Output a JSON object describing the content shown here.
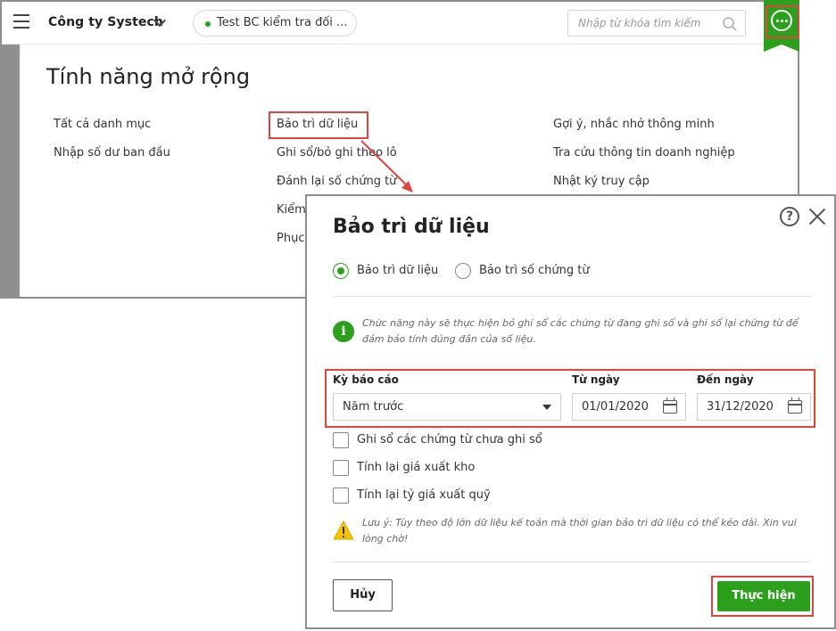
{
  "topbar": {
    "company_name": "Công ty Systech",
    "database_label": "Test BC kiểm tra đối ...",
    "search_placeholder": "Nhập từ khóa tìm kiếm"
  },
  "page": {
    "title": "Tính năng mở rộng",
    "features": {
      "col1": [
        "Tất cả danh mục",
        "Nhập số dư ban đầu"
      ],
      "col2": [
        "Bảo trì dữ liệu",
        "Ghi sổ/bỏ ghi theo lô",
        "Đánh lại số chứng từ",
        "Kiểm",
        "Phục"
      ],
      "col3": [
        "Gợi ý, nhắc nhở thông minh",
        "Tra cứu thông tin doanh nghiệp",
        "Nhật ký truy cập"
      ]
    }
  },
  "dialog": {
    "title": "Bảo trì dữ liệu",
    "radio_options": [
      "Bảo trì dữ liệu",
      "Bảo trì số chứng từ"
    ],
    "selected_option": "Bảo trì dữ liệu",
    "info_text_line1": "Chức năng này sẽ thực hiện bỏ ghi sổ các chứng từ đang ghi sổ và ghi sổ lại chứng từ để",
    "info_text_line2": "đảm bảo tính đúng đắn của số liệu.",
    "period_label": "Kỳ báo cáo",
    "period_value": "Năm trước",
    "from_label": "Từ ngày",
    "from_value": "01/01/2020",
    "to_label": "Đến ngày",
    "to_value": "31/12/2020",
    "checkboxes": [
      "Ghi sổ các chứng từ chưa ghi sổ",
      "Tính lại giá xuất kho",
      "Tính lại tỷ giá xuất quỹ"
    ],
    "warning_line1": "Lưu ý: Tùy theo độ lớn dữ liệu kế toán mà thời gian bảo trì dữ liệu có thể kéo dài. Xin vui",
    "warning_line2": "lòng chờ!",
    "cancel_label": "Hủy",
    "run_label": "Thực hiện"
  },
  "colors": {
    "accent_green": "#2ca01c",
    "highlight_red": "#e0443e"
  }
}
